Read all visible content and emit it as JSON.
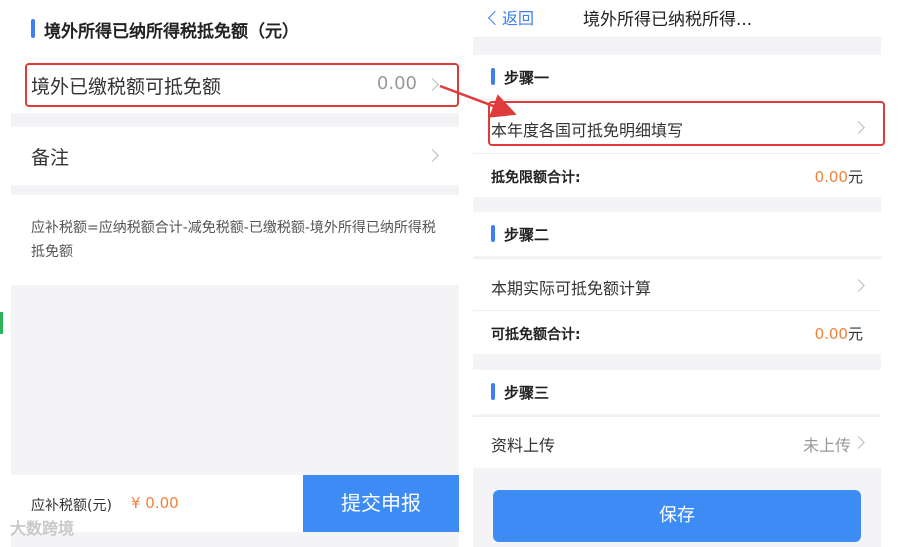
{
  "left": {
    "section_title": "境外所得已纳所得税抵免额（元）",
    "deduct_row": {
      "label": "境外已缴税额可抵免额",
      "value": "0.00"
    },
    "remark_row": {
      "label": "备注"
    },
    "formula": "应补税额=应纳税额合计-减免税额-已缴税额-境外所得已纳所得税抵免额",
    "footer": {
      "due_label": "应补税额(元)",
      "due_value": "¥ 0.00",
      "submit_label": "提交申报"
    },
    "watermark": "大数跨境"
  },
  "right": {
    "nav": {
      "back_label": "返回",
      "title": "境外所得已纳税所得..."
    },
    "step1": {
      "title": "步骤一",
      "row_label": "本年度各国可抵免明细填写",
      "sum_label": "抵免限额合计:",
      "sum_value": "0.00",
      "sum_unit": "元"
    },
    "step2": {
      "title": "步骤二",
      "row_label": "本期实际可抵免额计算",
      "sum_label": "可抵免额合计:",
      "sum_value": "0.00",
      "sum_unit": "元"
    },
    "step3": {
      "title": "步骤三",
      "row_label": "资料上传",
      "row_status": "未上传"
    },
    "save_label": "保存"
  },
  "colors": {
    "accent_blue": "#3d8bf5",
    "highlight_red": "#e03b3b",
    "amount_orange": "#f0823c"
  }
}
